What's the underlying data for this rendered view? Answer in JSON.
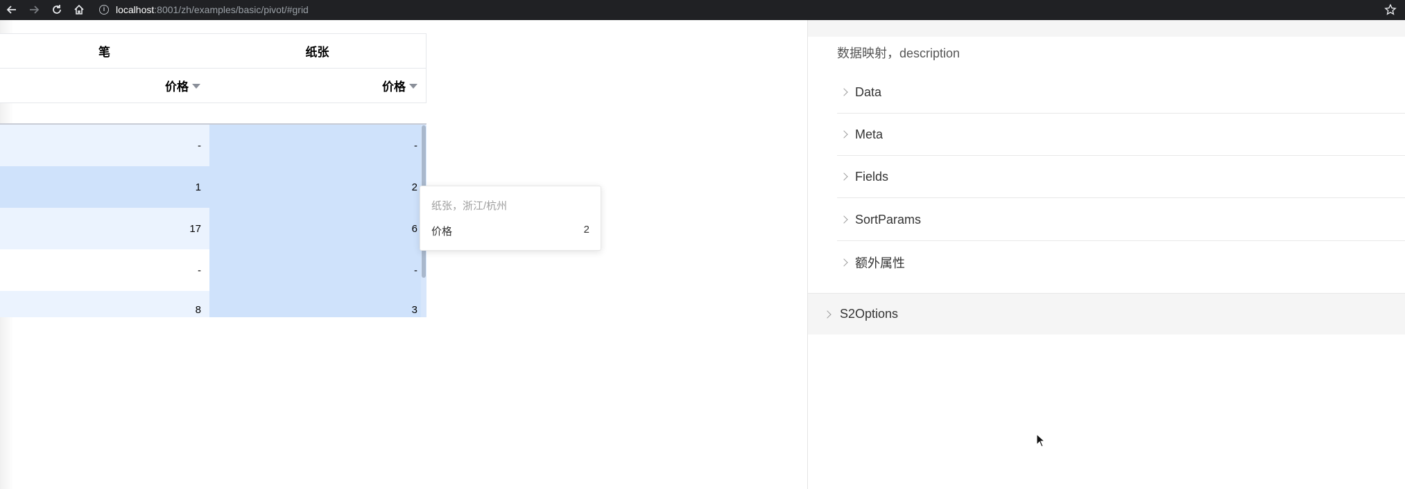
{
  "browser": {
    "url_host": "localhost",
    "url_path": ":8001/zh/examples/basic/pivot/#grid",
    "info_glyph": "i"
  },
  "table": {
    "col_headers": [
      {
        "label": "笔"
      },
      {
        "label": "纸张"
      }
    ],
    "measure_headers": [
      {
        "label": "价格"
      },
      {
        "label": "价格"
      }
    ],
    "rows": [
      {
        "values": [
          "-",
          "-"
        ]
      },
      {
        "values": [
          "1",
          "2"
        ]
      },
      {
        "values": [
          "17",
          "6"
        ]
      },
      {
        "values": [
          "-",
          "-"
        ]
      },
      {
        "values": [
          "8",
          "3"
        ]
      }
    ],
    "colors": {
      "selected": "#cfe2fb",
      "row_light": "#ebf3fe",
      "row_white": "#ffffff"
    }
  },
  "tooltip": {
    "title": "纸张，浙江/杭州",
    "label": "价格",
    "value": "2"
  },
  "panel": {
    "description": "数据映射，description",
    "items": [
      {
        "label": "Data"
      },
      {
        "label": "Meta"
      },
      {
        "label": "Fields"
      },
      {
        "label": "SortParams"
      },
      {
        "label": "额外属性"
      }
    ],
    "section": {
      "label": "S2Options"
    }
  }
}
